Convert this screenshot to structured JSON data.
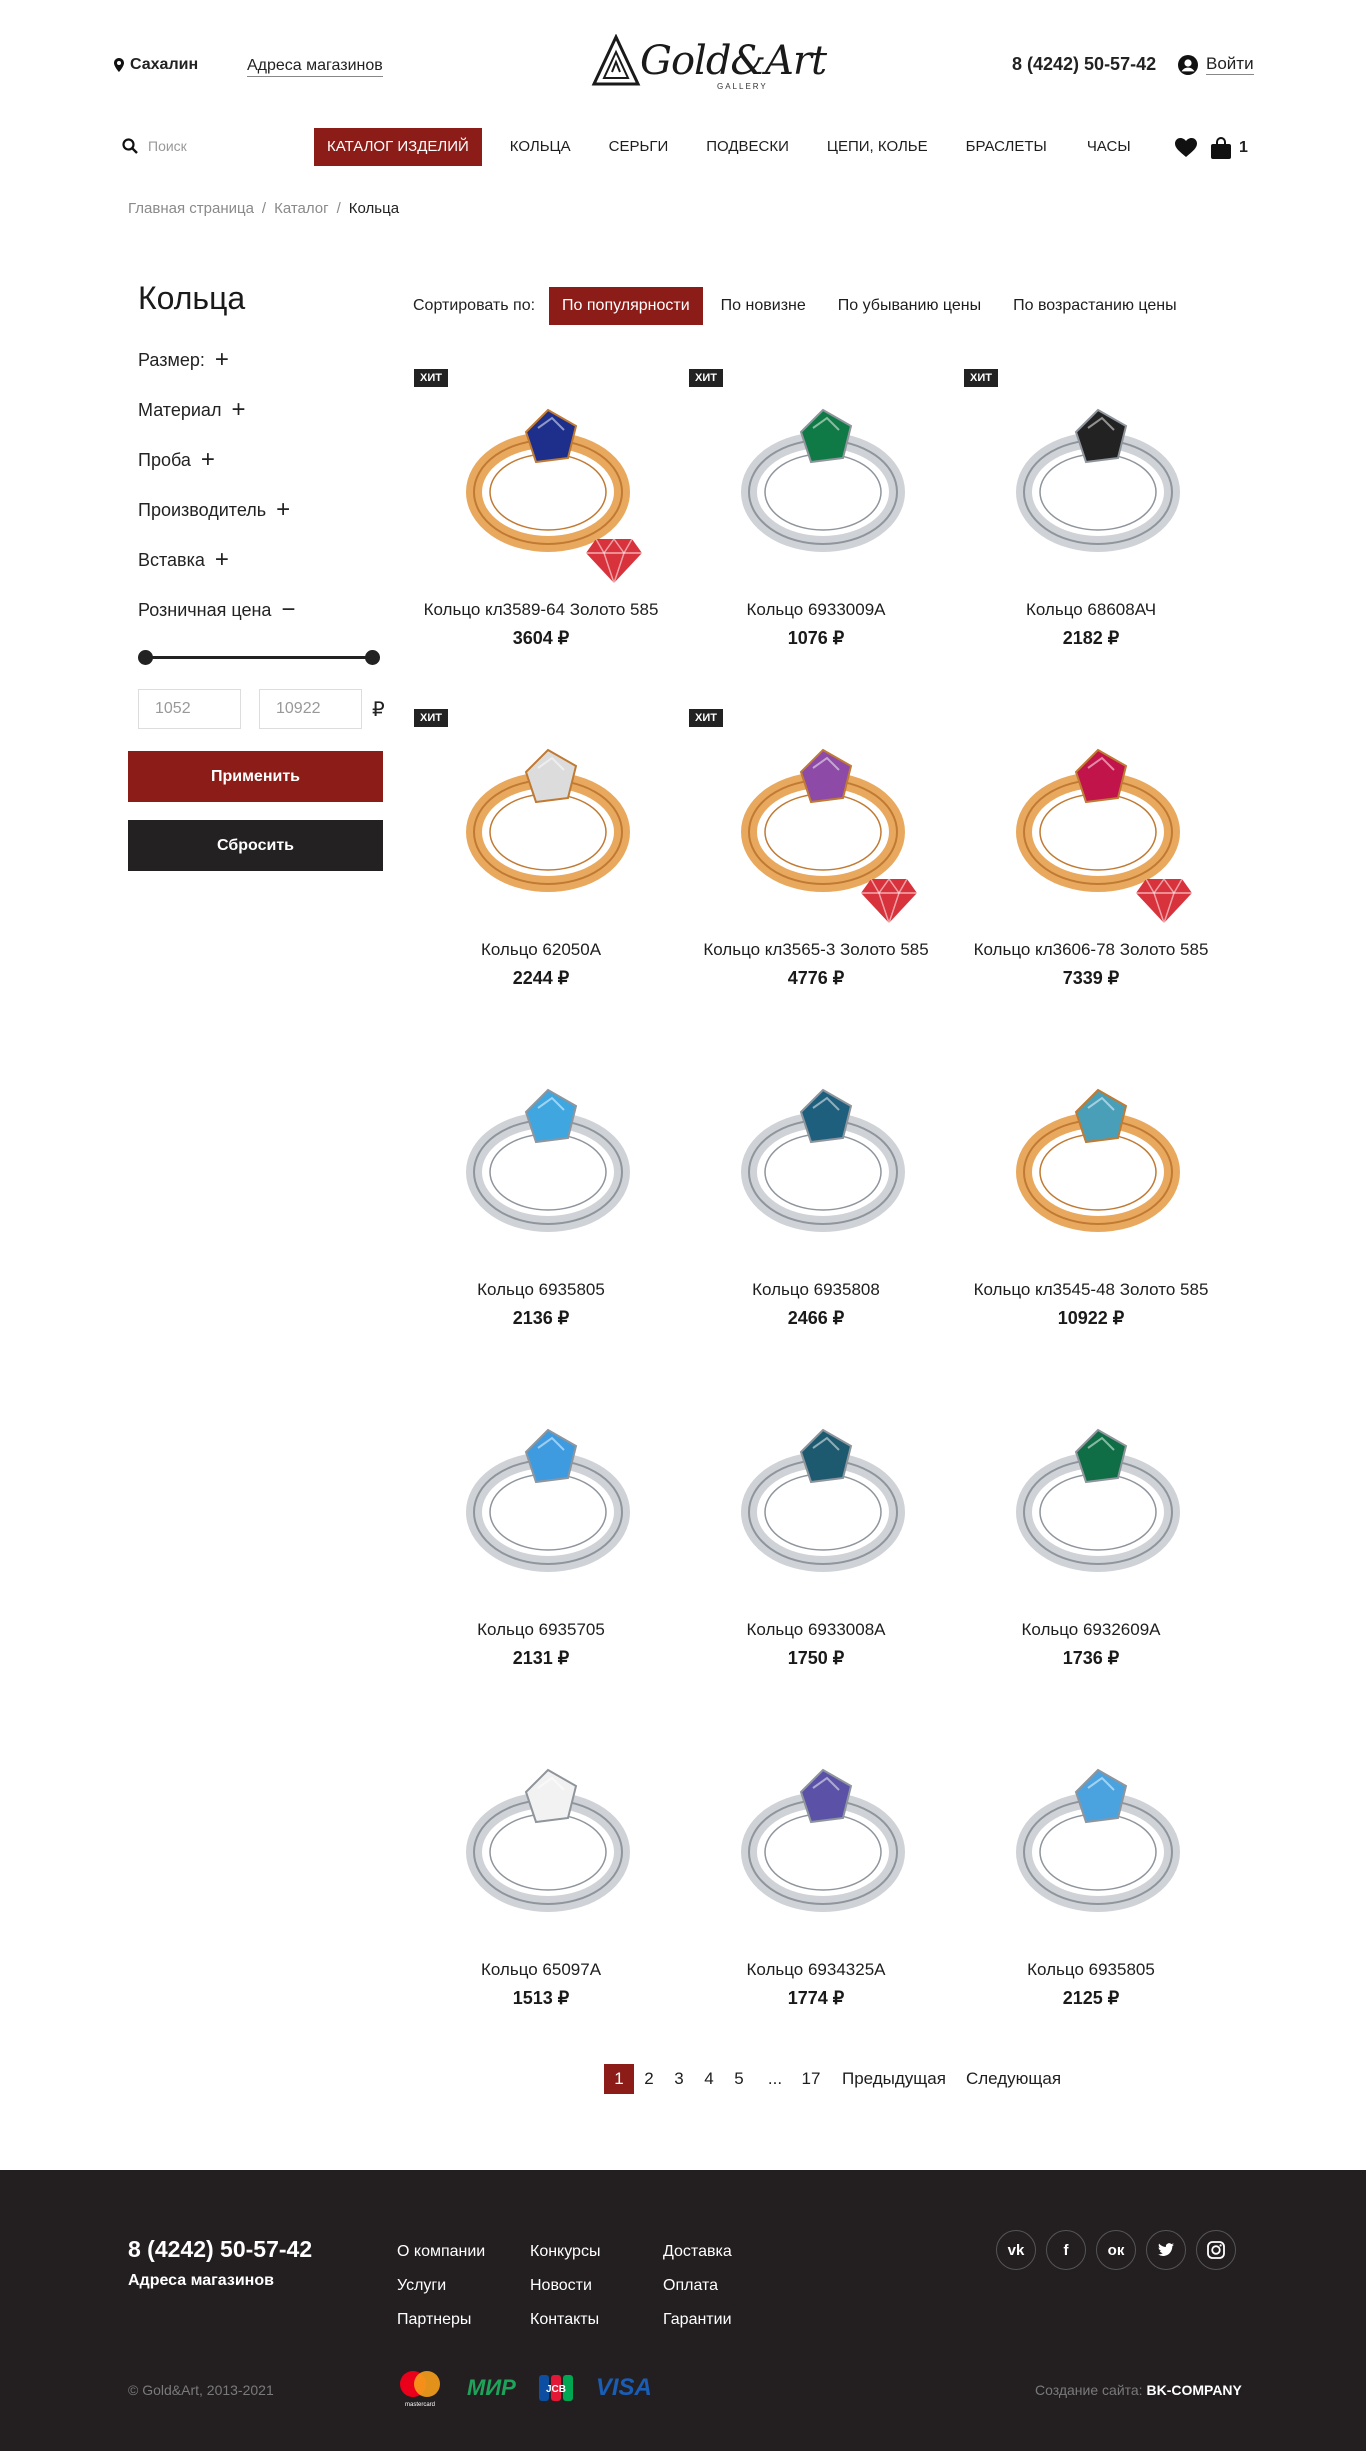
{
  "header": {
    "city": "Сахалин",
    "stores_link": "Адреса магазинов",
    "logo_text": "Gold&Art",
    "logo_sub": "GALLERY",
    "phone": "8 (4242) 50-57-42",
    "login": "Войти"
  },
  "search": {
    "placeholder": "Поиск"
  },
  "nav": {
    "items": [
      "КАТАЛОГ ИЗДЕЛИЙ",
      "КОЛЬЦА",
      "СЕРЬГИ",
      "ПОДВЕСКИ",
      "ЦЕПИ, КОЛЬЕ",
      "БРАСЛЕТЫ",
      "ЧАСЫ"
    ],
    "cart_count": "1"
  },
  "breadcrumb": [
    "Главная страница",
    "Каталог",
    "Кольца"
  ],
  "sidebar": {
    "title": "Кольца",
    "filters": [
      {
        "label": "Размер:",
        "sign": "+"
      },
      {
        "label": "Материал",
        "sign": "+"
      },
      {
        "label": "Проба",
        "sign": "+"
      },
      {
        "label": "Производитель",
        "sign": "+"
      },
      {
        "label": "Вставка",
        "sign": "+"
      },
      {
        "label": "Розничная цена",
        "sign": "−"
      }
    ],
    "price_min": "1052",
    "price_max": "10922",
    "currency": "₽",
    "apply": "Применить",
    "reset": "Сбросить"
  },
  "sort": {
    "label": "Сортировать по:",
    "options": [
      "По популярности",
      "По новизне",
      "По убыванию цены",
      "По возрастанию цены"
    ]
  },
  "products": [
    {
      "name": "Кольцо кл3589-64 Золото 585",
      "price": "3604 ₽",
      "badge": "ХИТ",
      "gem": true,
      "metal": "gold",
      "stone": "#1d2f8a"
    },
    {
      "name": "Кольцо 6933009А",
      "price": "1076 ₽",
      "badge": "ХИТ",
      "gem": false,
      "metal": "silver",
      "stone": "#0f7a45"
    },
    {
      "name": "Кольцо 68608АЧ",
      "price": "2182 ₽",
      "badge": "ХИТ",
      "gem": false,
      "metal": "silver",
      "stone": "#222222"
    },
    {
      "name": "Кольцо 62050А",
      "price": "2244 ₽",
      "badge": "ХИТ",
      "gem": false,
      "metal": "gold",
      "stone": "#dcdcdc"
    },
    {
      "name": "Кольцо кл3565-3 Золото 585",
      "price": "4776 ₽",
      "badge": "ХИТ",
      "gem": true,
      "metal": "gold",
      "stone": "#8d4aa6"
    },
    {
      "name": "Кольцо кл3606-78 Золото 585",
      "price": "7339 ₽",
      "badge": "",
      "gem": true,
      "metal": "gold",
      "stone": "#c0144a"
    },
    {
      "name": "Кольцо 6935805",
      "price": "2136 ₽",
      "badge": "",
      "gem": false,
      "metal": "silver",
      "stone": "#3fa6e0"
    },
    {
      "name": "Кольцо 6935808",
      "price": "2466 ₽",
      "badge": "",
      "gem": false,
      "metal": "silver",
      "stone": "#1f5f7e"
    },
    {
      "name": "Кольцо кл3545-48 Золото 585",
      "price": "10922 ₽",
      "badge": "",
      "gem": false,
      "metal": "gold",
      "stone": "#4a9fb8"
    },
    {
      "name": "Кольцо 6935705",
      "price": "2131 ₽",
      "badge": "",
      "gem": false,
      "metal": "silver",
      "stone": "#3f9be0"
    },
    {
      "name": "Кольцо 6933008А",
      "price": "1750 ₽",
      "badge": "",
      "gem": false,
      "metal": "silver",
      "stone": "#1d5a70"
    },
    {
      "name": "Кольцо 6932609А",
      "price": "1736 ₽",
      "badge": "",
      "gem": false,
      "metal": "silver",
      "stone": "#0f6e45"
    },
    {
      "name": "Кольцо 65097А",
      "price": "1513 ₽",
      "badge": "",
      "gem": false,
      "metal": "silver",
      "stone": "#f2f2f2"
    },
    {
      "name": "Кольцо 6934325А",
      "price": "1774 ₽",
      "badge": "",
      "gem": false,
      "metal": "silver",
      "stone": "#5b52a8"
    },
    {
      "name": "Кольцо 6935805",
      "price": "2125 ₽",
      "badge": "",
      "gem": false,
      "metal": "silver",
      "stone": "#4aa3df"
    }
  ],
  "pagination": [
    "1",
    "2",
    "3",
    "4",
    "5",
    "...",
    "17",
    "Предыдущая",
    "Следующая"
  ],
  "footer": {
    "phone": "8 (4242) 50-57-42",
    "stores": "Адреса магазинов",
    "col1": [
      "О компании",
      "Услуги",
      "Партнеры"
    ],
    "col2": [
      "Конкурсы",
      "Новости",
      "Контакты"
    ],
    "col3": [
      "Доставка",
      "Оплата",
      "Гарантии"
    ],
    "social": [
      "vk",
      "f",
      "ok",
      "tw",
      "ig"
    ],
    "copyright": "© Gold&Art, 2013-2021",
    "payments": [
      "mastercard",
      "МИР",
      "JCB",
      "VISA"
    ],
    "made_label": "Создание сайта:",
    "made_by": "BK-COMPANY"
  },
  "colors": {
    "accent": "#8b1c17",
    "dark": "#231f20"
  }
}
